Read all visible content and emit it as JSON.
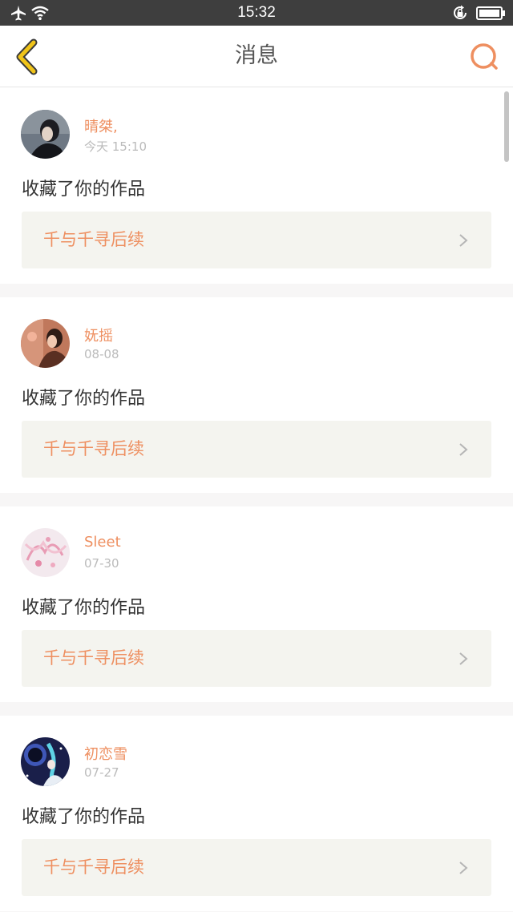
{
  "status_bar": {
    "time": "15:32",
    "icons": [
      "airplane-icon",
      "wifi-icon",
      "rotation-lock-icon",
      "battery-icon"
    ]
  },
  "header": {
    "title": "消息",
    "back_icon": "chevron-left-icon",
    "search_icon": "search-icon",
    "accent_back": "#f0c419",
    "accent_search": "#ee8f60"
  },
  "colors": {
    "accent": "#ee8f60",
    "date": "#bbbbbb",
    "body_text": "#333333",
    "work_bg": "#f4f4ef",
    "separator": "#f7f6f6"
  },
  "messages": [
    {
      "user": "晴桀,",
      "date": "今天 15:10",
      "action": "收藏了你的作品",
      "work": "千与千寻后续"
    },
    {
      "user": "妩摇",
      "date": "08-08",
      "action": "收藏了你的作品",
      "work": "千与千寻后续"
    },
    {
      "user": "Sleet",
      "date": "07-30",
      "action": "收藏了你的作品",
      "work": "千与千寻后续"
    },
    {
      "user": "初恋雪",
      "date": "07-27",
      "action": "收藏了你的作品",
      "work": "千与千寻后续"
    }
  ]
}
